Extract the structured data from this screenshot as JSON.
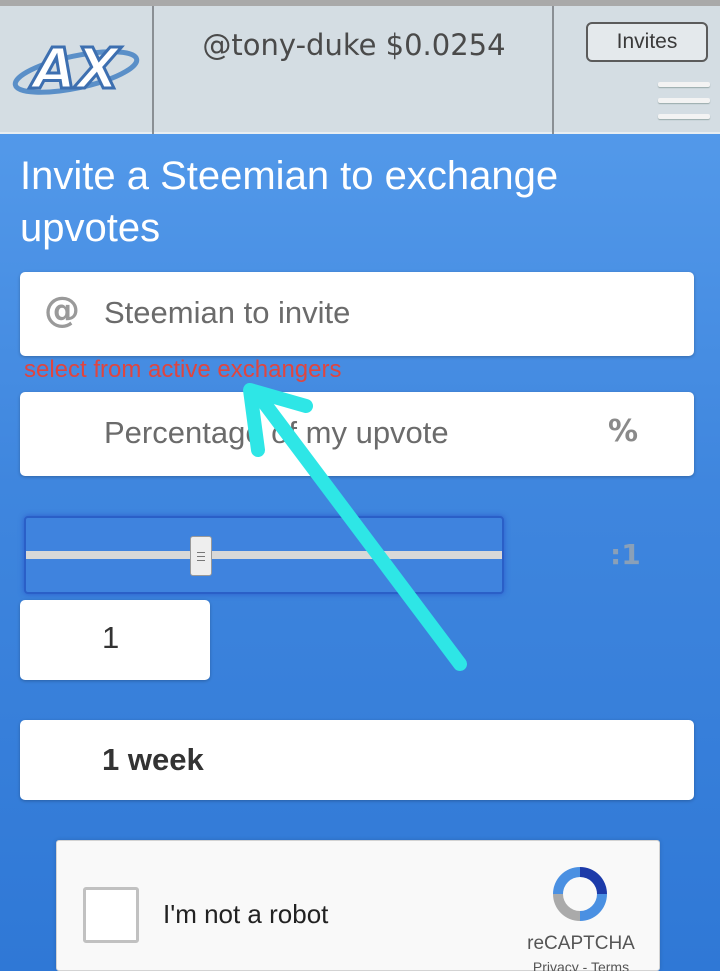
{
  "header": {
    "logo_text": "AX",
    "account": "@tony-duke $0.0254",
    "invites_label": "Invites"
  },
  "main": {
    "title": "Invite a Steemian to exchange upvotes",
    "invitee_placeholder": "Steemian to invite",
    "invitee_hint": "select from active exchangers",
    "percentage_placeholder": "Percentage of my upvote",
    "percentage_suffix": "%",
    "ratio_suffix": ":1",
    "ratio_value": "1",
    "duration_value": "1 week"
  },
  "captcha": {
    "label": "I'm not a robot",
    "brand": "reCAPTCHA",
    "links": "Privacy - Terms"
  },
  "colors": {
    "background": "#3f86de",
    "hint": "#e0453f",
    "annotation_arrow": "#2ee6e6"
  }
}
